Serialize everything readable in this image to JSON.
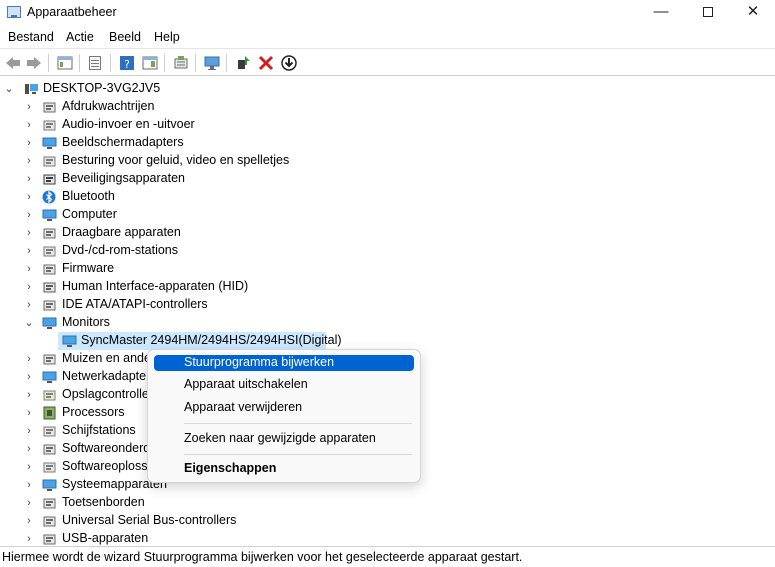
{
  "window": {
    "title": "Apparaatbeheer",
    "minimize": "—",
    "close": "✕"
  },
  "menu": [
    "Bestand",
    "Actie",
    "Beeld",
    "Help"
  ],
  "toolbar": [
    "back",
    "forward",
    "properties-panel",
    "properties",
    "help",
    "action-pane",
    "scan",
    "monitor",
    "update-driver",
    "uninstall",
    "download"
  ],
  "tree": {
    "root": "DESKTOP-3VG2JV5",
    "categories": [
      "Afdrukwachtrijen",
      "Audio-invoer en -uitvoer",
      "Beeldschermadapters",
      "Besturing voor geluid, video en spelletjes",
      "Beveiligingsapparaten",
      "Bluetooth",
      "Computer",
      "Draagbare apparaten",
      "Dvd-/cd-rom-stations",
      "Firmware",
      "Human Interface-apparaten (HID)",
      "IDE ATA/ATAPI-controllers",
      "Monitors",
      "Muizen en ande",
      "Netwerkadapter",
      "Opslagcontrolle",
      "Processors",
      "Schijfstations",
      "Softwareonderd",
      "Softwareoplossi",
      "Systeemapparaten",
      "Toetsenborden",
      "Universal Serial Bus-controllers",
      "USB-apparaten"
    ],
    "selected_device": "SyncMaster 2494HM/2494HS/2494HSI(Digital)"
  },
  "context_menu": {
    "items": [
      "Stuurprogramma bijwerken",
      "Apparaat uitschakelen",
      "Apparaat verwijderen",
      "Zoeken naar gewijzigde apparaten",
      "Eigenschappen"
    ]
  },
  "status": "Hiermee wordt de wizard Stuurprogramma bijwerken voor het geselecteerde apparaat gestart.",
  "colors": {
    "accent": "#0063d2",
    "selection": "#cce8ff"
  }
}
